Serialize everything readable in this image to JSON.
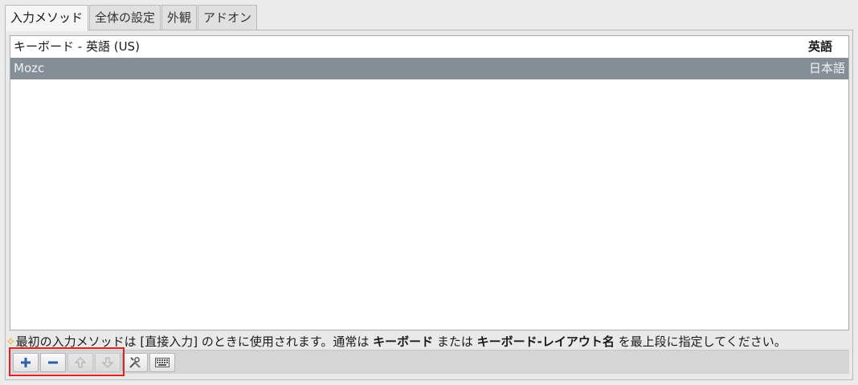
{
  "tabs": [
    {
      "label": "入力メソッド",
      "active": true
    },
    {
      "label": "全体の設定",
      "active": false
    },
    {
      "label": "外観",
      "active": false
    },
    {
      "label": "アドオン",
      "active": false
    }
  ],
  "list": {
    "rows": [
      {
        "name": "キーボード - 英語 (US)",
        "language": "英語"
      },
      {
        "name": "Mozc",
        "language": "日本語",
        "selected": true
      }
    ]
  },
  "hint": {
    "part1": "最初の入力メソッドは [直接入力] のときに使用されます。通常は ",
    "bold1": "キーボード",
    "part2": " または ",
    "bold2": "キーボード-レイアウト名",
    "part3": " を最上段に指定してください。"
  },
  "toolbar": {
    "buttons": [
      {
        "icon": "plus-icon",
        "enabled": true
      },
      {
        "icon": "minus-icon",
        "enabled": true
      },
      {
        "icon": "arrow-up-icon",
        "enabled": false
      },
      {
        "icon": "arrow-down-icon",
        "enabled": false
      },
      {
        "icon": "configure-icon",
        "enabled": true
      },
      {
        "icon": "keyboard-icon",
        "enabled": true
      }
    ]
  },
  "colors": {
    "selected_row": "#868f98",
    "highlight_box": "#e21f1f",
    "plus_minus": "#2a5fa8"
  }
}
